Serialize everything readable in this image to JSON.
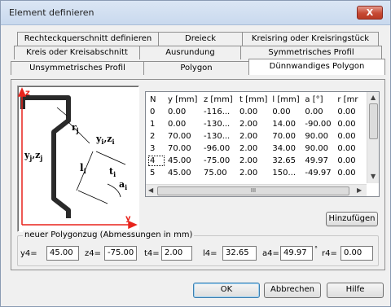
{
  "window": {
    "title": "Element definieren",
    "close_label": "X"
  },
  "tabs": {
    "row1": [
      "Rechteckquerschnitt definieren",
      "Dreieck",
      "Kreisring oder Kreisringstück"
    ],
    "row2": [
      "Kreis oder Kreisabschnitt",
      "Ausrundung",
      "Symmetrisches Profil"
    ],
    "row3": [
      "Unsymmetrisches Profil",
      "Polygon",
      "Dünnwandiges Polygon"
    ],
    "active": "Dünnwandiges Polygon"
  },
  "figure": {
    "axis_z": "z",
    "axis_y": "y",
    "label_rj": "r",
    "label_rj_sub": "j",
    "label_yizi": "y",
    "label_yizi_sub": "i",
    "label_yizi_mid": ",z",
    "label_yizi_sub2": "i",
    "label_yjzj": "y",
    "label_yjzj_sub": "j",
    "label_yjzj_mid": ",z",
    "label_yjzj_sub2": "j",
    "label_li": "l",
    "label_li_sub": "i",
    "label_ti": "t",
    "label_ti_sub": "i",
    "label_ai": "a",
    "label_ai_sub": "i"
  },
  "table": {
    "headers": [
      "N",
      "y [mm]",
      "z [mm]",
      "t [mm]",
      "l [mm]",
      "a [°]",
      "r [mr"
    ],
    "rows": [
      [
        "0",
        "0.00",
        "-116...",
        "0.00",
        "0.00",
        "0.00",
        "0.00"
      ],
      [
        "1",
        "0.00",
        "-130...",
        "2.00",
        "14.00",
        "-90.00",
        "0.00"
      ],
      [
        "2",
        "70.00",
        "-130...",
        "2.00",
        "70.00",
        "90.00",
        "0.00"
      ],
      [
        "3",
        "70.00",
        "-96.00",
        "2.00",
        "34.00",
        "90.00",
        "0.00"
      ],
      [
        "4",
        "45.00",
        "-75.00",
        "2.00",
        "32.65",
        "49.97",
        "0.00"
      ],
      [
        "5",
        "45.00",
        "75.00",
        "2.00",
        "150...",
        "-49.97",
        "0.00"
      ]
    ],
    "selected_row": "4",
    "hscroll_grip": "III"
  },
  "buttons": {
    "add": "Hinzufügen",
    "ok": "OK",
    "cancel": "Abbrechen",
    "help": "Hilfe"
  },
  "form": {
    "legend": "neuer Polygonzug (Abmessungen in mm)",
    "y_label": "y4=",
    "y_value": "45.00",
    "z_label": "z4=",
    "z_value": "-75.00",
    "t_label": "t4=",
    "t_value": "2.00",
    "l_label": "l4=",
    "l_value": "32.65",
    "a_label": "a4=",
    "a_value": "49.97",
    "a_unit": "°",
    "r_label": "r4=",
    "r_value": "0.00"
  },
  "colors": {
    "accent_red": "#e8241c",
    "thumbnail_profile": "#2a2a2a",
    "title_gradient": "#dbe6f4"
  }
}
